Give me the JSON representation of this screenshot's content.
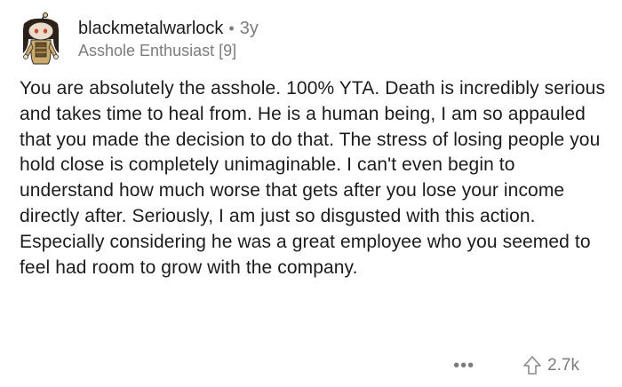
{
  "comment": {
    "author": "blackmetalwarlock",
    "separator": "•",
    "age": "3y",
    "flair": "Asshole Enthusiast [9]",
    "body": "You are absolutely the asshole. 100% YTA. Death is incredibly serious and takes time to heal from. He is a human being, I am so appauled that you made the decision to do that. The stress of losing people you hold close is completely unimaginable. I can't even begin to understand how much worse that gets after you lose your income directly after. Seriously, I am just so disgusted with this action. Especially considering he was a great employee who you seemed to feel had room to grow with the company.",
    "more_label": "•••",
    "score": "2.7k",
    "avatar_icon": "snoo-avatar-icon",
    "upvote_icon": "upvote-arrow-icon"
  },
  "colors": {
    "text": "#1c1c1c",
    "muted": "#7c7c7c",
    "background": "#ffffff"
  }
}
